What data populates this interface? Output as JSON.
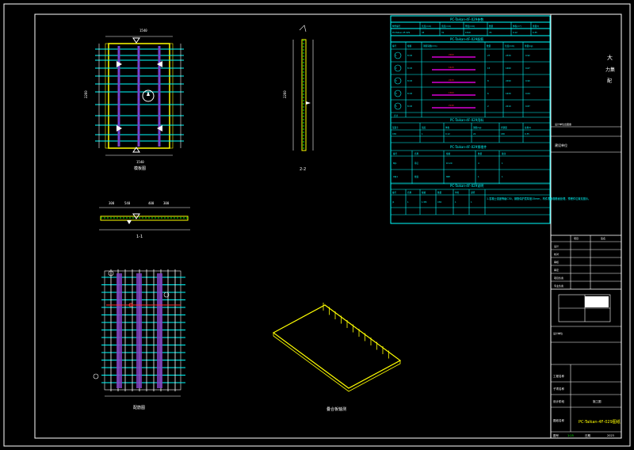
{
  "drawing": {
    "title": "PC-Taikan-4F-029图纸",
    "sheet_no": "2023",
    "scale_label": "1:25",
    "side_notes": [
      "大",
      "力集",
      "配"
    ],
    "side_label": "建设单位"
  },
  "views": {
    "plan_title": "模板图",
    "section_1": "1-1",
    "section_2": "2-2",
    "rebar_title": "配筋图",
    "iso_title": "叠合板轴测"
  },
  "table_main": {
    "title": "PC-Taikan-4F-029参数",
    "headers": [
      "构件编号",
      "长度(mm)",
      "宽度(mm)",
      "厚度(mm)",
      "数量",
      "体积(m³)",
      "重量(t)"
    ],
    "row": [
      "PC-Taikan-4F-029",
      "43",
      "31",
      "1549",
      "70",
      "0.12",
      "0.35"
    ]
  },
  "table_rebar": {
    "title": "PC-Taikan-4F-029配筋",
    "headers": [
      "编号",
      "规格",
      "钢筋简图(mm)",
      "数量",
      "长度(mm)",
      "重量(kg)"
    ],
    "rows": [
      [
        "1",
        "8 C8",
        "2260",
        "27",
        "2330",
        "0.92"
      ],
      [
        "2",
        "8 C8",
        "1620",
        "15",
        "1690",
        "0.67"
      ],
      [
        "3",
        "8 C8",
        "2220",
        "8",
        "2290",
        "0.90"
      ],
      [
        "4",
        "8 C8",
        "1560",
        "6",
        "1630",
        "0.64"
      ],
      [
        "5",
        "8 C8",
        "2140",
        "2",
        "2210",
        "0.87"
      ]
    ],
    "total_label": "合计"
  },
  "table_concrete": {
    "title": "PC-Taikan-4F-029用料",
    "headers": [
      "混凝土",
      "强度",
      "体积",
      "钢筋(kg)",
      "含钢量",
      "总重(t)"
    ],
    "row": [
      "C30",
      "1",
      "0.12",
      "22",
      "180",
      "0.35"
    ]
  },
  "table_embed": {
    "title": "PC-Taikan-4F-029预埋件",
    "headers": [
      "编号",
      "名称",
      "规格",
      "数量",
      "备注"
    ],
    "rows": [
      [
        "MJ1",
        "吊钉",
        "D=20",
        "4",
        "1"
      ],
      [
        "XZJ1",
        "线盒",
        "86H",
        "1",
        "1"
      ]
    ]
  },
  "table_notes": {
    "title": "PC-Taikan-4F-029说明",
    "headers": [
      "编号",
      "名称",
      "规格",
      "数量",
      "单位",
      "说明"
    ],
    "row": [
      "J1",
      "1",
      "1.5M",
      "C30",
      "1",
      "1"
    ],
    "note": "1.混凝土强度等级C30，钢筋保护层厚度15mm，构件表面粗糙面处理，预埋件位置见图示。"
  },
  "title_block": {
    "header": [
      "项目",
      "签名"
    ],
    "rows": [
      "设计",
      "校对",
      "审核",
      "审定",
      "项目负责",
      "专业负责"
    ],
    "company_label": "设计单位",
    "project_label": "工程名称",
    "sub_label": "子项名称",
    "drawing_label": "图纸名称",
    "stage_label": "设计阶段",
    "no_label": "图号",
    "scale_label": "比例",
    "date_label": "日期",
    "stage_value": "施工图"
  },
  "colors": {
    "frame": "#ffffff",
    "cyan": "#00ffff",
    "yellow": "#ffff00",
    "green": "#00ff00",
    "magenta": "#ff00ff",
    "purple": "#7f3fbf",
    "red": "#ff3030"
  }
}
